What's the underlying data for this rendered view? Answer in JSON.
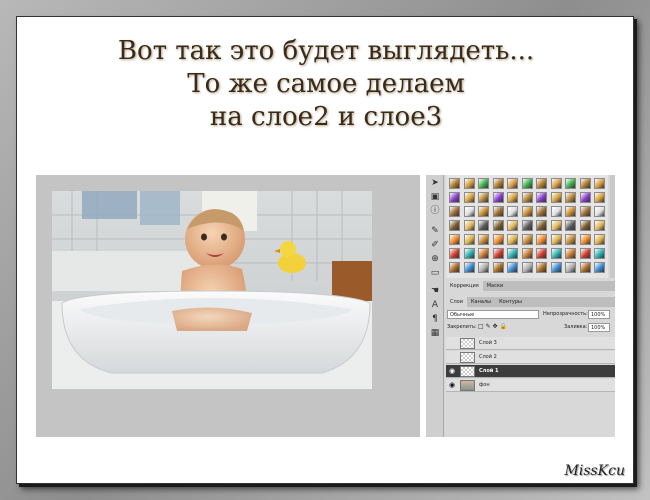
{
  "title": {
    "line1": "Вот так это будет выглядеть...",
    "line2": "То же самое делаем",
    "line3": "на слое2 и слое3"
  },
  "panels": {
    "top_tabs": [
      "Коррекция",
      "Маски"
    ],
    "layer_tabs": [
      "Слои",
      "Каналы",
      "Контуры"
    ],
    "blend_mode": "Обычные",
    "opacity_label": "Непрозрачность:",
    "opacity_value": "100%",
    "lock_label": "Закрепить:",
    "fill_label": "Заливка:",
    "fill_value": "100%"
  },
  "layers": [
    {
      "name": "Слой 3",
      "visible": false,
      "selected": false
    },
    {
      "name": "Слой 2",
      "visible": false,
      "selected": false
    },
    {
      "name": "Слой 1",
      "visible": true,
      "selected": true
    },
    {
      "name": "фон",
      "visible": true,
      "selected": false
    }
  ],
  "tools": [
    {
      "icon": "arrow-icon"
    },
    {
      "icon": "image-icon"
    },
    {
      "icon": "info-icon"
    },
    {
      "icon": "brush-icon"
    },
    {
      "icon": "pencil-icon"
    },
    {
      "icon": "stamp-icon"
    },
    {
      "icon": "eraser-icon"
    },
    {
      "icon": "hand-icon"
    },
    {
      "icon": "type-icon"
    },
    {
      "icon": "ruler-icon"
    },
    {
      "icon": "grid-icon"
    }
  ],
  "swatch_colors": [
    "#b07a2a",
    "#d9a13a",
    "#c98c2e",
    "#7a5a2a",
    "#e0b24a",
    "#c7772c",
    "#a96a24",
    "#d69a40",
    "#b5853a",
    "#9a6a30",
    "#e3b85c",
    "#c58a38"
  ],
  "signature": "MissKcu"
}
